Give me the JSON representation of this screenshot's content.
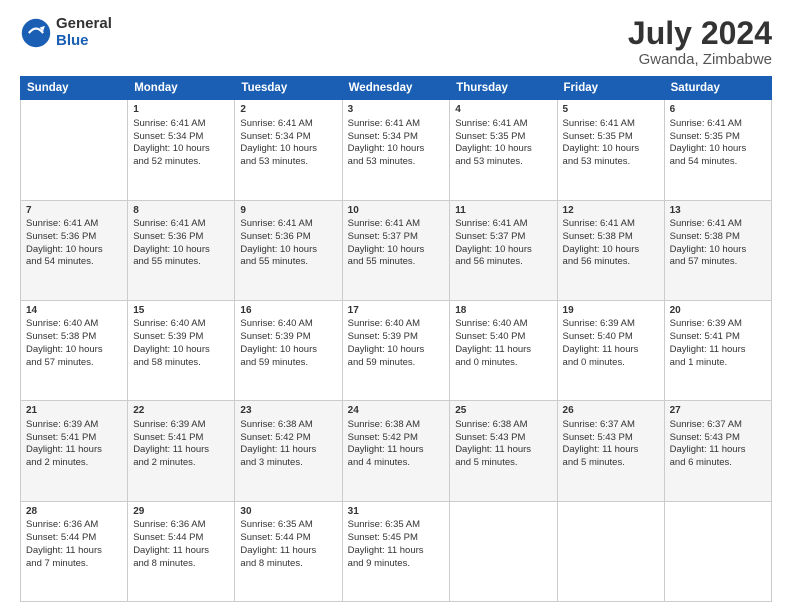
{
  "logo": {
    "general": "General",
    "blue": "Blue"
  },
  "title": {
    "month_year": "July 2024",
    "location": "Gwanda, Zimbabwe"
  },
  "days_header": [
    "Sunday",
    "Monday",
    "Tuesday",
    "Wednesday",
    "Thursday",
    "Friday",
    "Saturday"
  ],
  "weeks": [
    [
      {
        "day": "",
        "info": ""
      },
      {
        "day": "1",
        "info": "Sunrise: 6:41 AM\nSunset: 5:34 PM\nDaylight: 10 hours\nand 52 minutes."
      },
      {
        "day": "2",
        "info": "Sunrise: 6:41 AM\nSunset: 5:34 PM\nDaylight: 10 hours\nand 53 minutes."
      },
      {
        "day": "3",
        "info": "Sunrise: 6:41 AM\nSunset: 5:34 PM\nDaylight: 10 hours\nand 53 minutes."
      },
      {
        "day": "4",
        "info": "Sunrise: 6:41 AM\nSunset: 5:35 PM\nDaylight: 10 hours\nand 53 minutes."
      },
      {
        "day": "5",
        "info": "Sunrise: 6:41 AM\nSunset: 5:35 PM\nDaylight: 10 hours\nand 53 minutes."
      },
      {
        "day": "6",
        "info": "Sunrise: 6:41 AM\nSunset: 5:35 PM\nDaylight: 10 hours\nand 54 minutes."
      }
    ],
    [
      {
        "day": "7",
        "info": "Sunrise: 6:41 AM\nSunset: 5:36 PM\nDaylight: 10 hours\nand 54 minutes."
      },
      {
        "day": "8",
        "info": "Sunrise: 6:41 AM\nSunset: 5:36 PM\nDaylight: 10 hours\nand 55 minutes."
      },
      {
        "day": "9",
        "info": "Sunrise: 6:41 AM\nSunset: 5:36 PM\nDaylight: 10 hours\nand 55 minutes."
      },
      {
        "day": "10",
        "info": "Sunrise: 6:41 AM\nSunset: 5:37 PM\nDaylight: 10 hours\nand 55 minutes."
      },
      {
        "day": "11",
        "info": "Sunrise: 6:41 AM\nSunset: 5:37 PM\nDaylight: 10 hours\nand 56 minutes."
      },
      {
        "day": "12",
        "info": "Sunrise: 6:41 AM\nSunset: 5:38 PM\nDaylight: 10 hours\nand 56 minutes."
      },
      {
        "day": "13",
        "info": "Sunrise: 6:41 AM\nSunset: 5:38 PM\nDaylight: 10 hours\nand 57 minutes."
      }
    ],
    [
      {
        "day": "14",
        "info": "Sunrise: 6:40 AM\nSunset: 5:38 PM\nDaylight: 10 hours\nand 57 minutes."
      },
      {
        "day": "15",
        "info": "Sunrise: 6:40 AM\nSunset: 5:39 PM\nDaylight: 10 hours\nand 58 minutes."
      },
      {
        "day": "16",
        "info": "Sunrise: 6:40 AM\nSunset: 5:39 PM\nDaylight: 10 hours\nand 59 minutes."
      },
      {
        "day": "17",
        "info": "Sunrise: 6:40 AM\nSunset: 5:39 PM\nDaylight: 10 hours\nand 59 minutes."
      },
      {
        "day": "18",
        "info": "Sunrise: 6:40 AM\nSunset: 5:40 PM\nDaylight: 11 hours\nand 0 minutes."
      },
      {
        "day": "19",
        "info": "Sunrise: 6:39 AM\nSunset: 5:40 PM\nDaylight: 11 hours\nand 0 minutes."
      },
      {
        "day": "20",
        "info": "Sunrise: 6:39 AM\nSunset: 5:41 PM\nDaylight: 11 hours\nand 1 minute."
      }
    ],
    [
      {
        "day": "21",
        "info": "Sunrise: 6:39 AM\nSunset: 5:41 PM\nDaylight: 11 hours\nand 2 minutes."
      },
      {
        "day": "22",
        "info": "Sunrise: 6:39 AM\nSunset: 5:41 PM\nDaylight: 11 hours\nand 2 minutes."
      },
      {
        "day": "23",
        "info": "Sunrise: 6:38 AM\nSunset: 5:42 PM\nDaylight: 11 hours\nand 3 minutes."
      },
      {
        "day": "24",
        "info": "Sunrise: 6:38 AM\nSunset: 5:42 PM\nDaylight: 11 hours\nand 4 minutes."
      },
      {
        "day": "25",
        "info": "Sunrise: 6:38 AM\nSunset: 5:43 PM\nDaylight: 11 hours\nand 5 minutes."
      },
      {
        "day": "26",
        "info": "Sunrise: 6:37 AM\nSunset: 5:43 PM\nDaylight: 11 hours\nand 5 minutes."
      },
      {
        "day": "27",
        "info": "Sunrise: 6:37 AM\nSunset: 5:43 PM\nDaylight: 11 hours\nand 6 minutes."
      }
    ],
    [
      {
        "day": "28",
        "info": "Sunrise: 6:36 AM\nSunset: 5:44 PM\nDaylight: 11 hours\nand 7 minutes."
      },
      {
        "day": "29",
        "info": "Sunrise: 6:36 AM\nSunset: 5:44 PM\nDaylight: 11 hours\nand 8 minutes."
      },
      {
        "day": "30",
        "info": "Sunrise: 6:35 AM\nSunset: 5:44 PM\nDaylight: 11 hours\nand 8 minutes."
      },
      {
        "day": "31",
        "info": "Sunrise: 6:35 AM\nSunset: 5:45 PM\nDaylight: 11 hours\nand 9 minutes."
      },
      {
        "day": "",
        "info": ""
      },
      {
        "day": "",
        "info": ""
      },
      {
        "day": "",
        "info": ""
      }
    ]
  ]
}
